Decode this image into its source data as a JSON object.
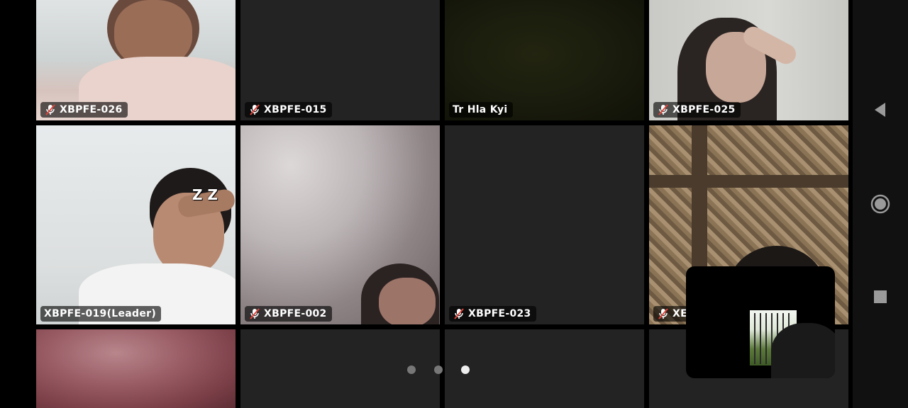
{
  "tiles": [
    {
      "name": "XBPFE-026",
      "muted": true
    },
    {
      "name": "XBPFE-015",
      "muted": true
    },
    {
      "name": "Tr Hla Kyi",
      "muted": false
    },
    {
      "name": "XBPFE-025",
      "muted": true
    },
    {
      "name": "XBPFE-019(Leader)",
      "muted": false,
      "reaction": "Z Z"
    },
    {
      "name": "XBPFE-002",
      "muted": true
    },
    {
      "name": "XBPFE-023",
      "muted": true
    },
    {
      "name": "XE",
      "muted": true
    }
  ],
  "pagination": {
    "pages": 3,
    "current": 3
  },
  "nav": {
    "back": "back-icon",
    "home": "home-icon",
    "recents": "recents-icon"
  },
  "colors": {
    "tile_bg": "#232323",
    "muted_red": "#e0443a"
  }
}
